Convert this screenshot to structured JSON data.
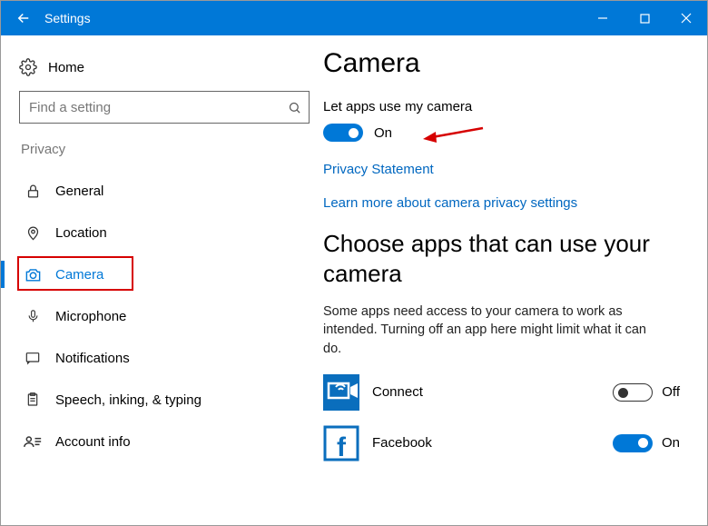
{
  "window": {
    "title": "Settings"
  },
  "sidebar": {
    "home_label": "Home",
    "search_placeholder": "Find a setting",
    "section_label": "Privacy",
    "items": [
      {
        "label": "General"
      },
      {
        "label": "Location"
      },
      {
        "label": "Camera"
      },
      {
        "label": "Microphone"
      },
      {
        "label": "Notifications"
      },
      {
        "label": "Speech, inking, & typing"
      },
      {
        "label": "Account info"
      }
    ]
  },
  "main": {
    "page_title": "Camera",
    "enable_label": "Let apps use my camera",
    "enable_state": "On",
    "links": {
      "privacy_statement": "Privacy Statement",
      "learn_more": "Learn more about camera privacy settings"
    },
    "choose_section": {
      "heading": "Choose apps that can use your camera",
      "description": "Some apps need access to your camera to work as intended. Turning off an app here might limit what it can do."
    },
    "apps": [
      {
        "name": "Connect",
        "state": "Off"
      },
      {
        "name": "Facebook",
        "state": "On"
      }
    ]
  },
  "colors": {
    "accent": "#0078d7",
    "highlight": "#d60000"
  }
}
